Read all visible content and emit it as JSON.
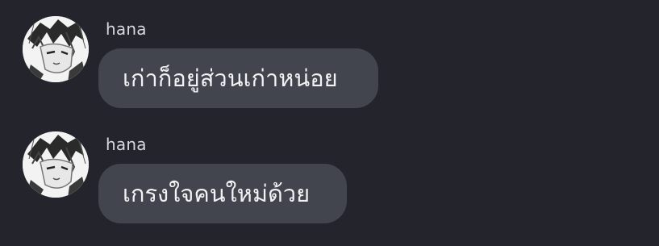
{
  "messages": [
    {
      "username": "hana",
      "text": "เก่าก็อยู่ส่วนเก่าหน่อย",
      "avatar": "manga-character-avatar"
    },
    {
      "username": "hana",
      "text": "เกรงใจคนใหม่ด้วย",
      "avatar": "manga-character-avatar"
    }
  ],
  "colors": {
    "background": "#24252c",
    "bubble": "#42454e",
    "username": "#d8d9de",
    "message_text": "#f2f2f4"
  }
}
